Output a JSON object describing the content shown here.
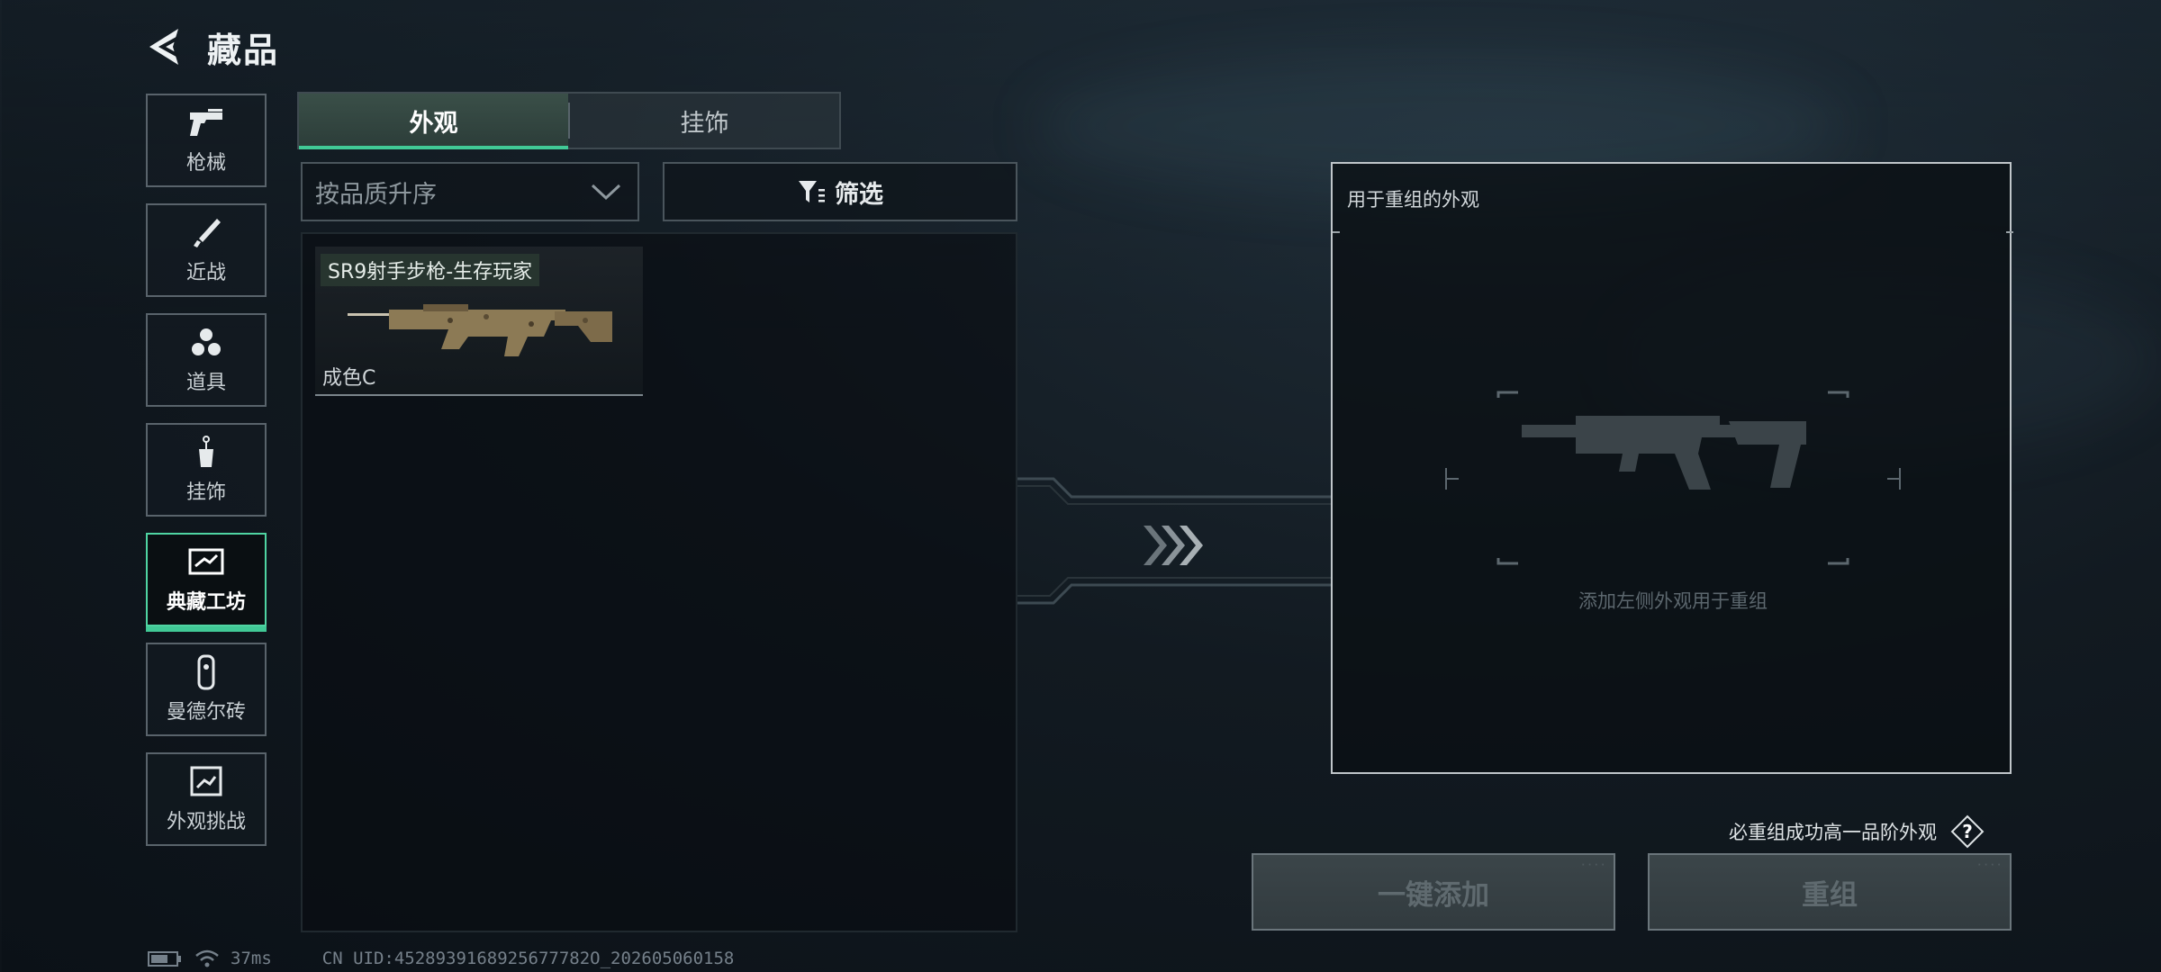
{
  "header": {
    "title": "藏品",
    "back_icon": "back-arrow-icon"
  },
  "sidebar": {
    "items": [
      {
        "label": "枪械",
        "icon": "pistol-icon",
        "active": false
      },
      {
        "label": "近战",
        "icon": "knife-icon",
        "active": false
      },
      {
        "label": "道具",
        "icon": "grenade-cluster-icon",
        "active": false
      },
      {
        "label": "挂饰",
        "icon": "charm-icon",
        "active": false
      },
      {
        "label": "典藏工坊",
        "icon": "workshop-icon",
        "active": true
      },
      {
        "label": "曼德尔砖",
        "icon": "brick-icon",
        "active": false
      },
      {
        "label": "外观挑战",
        "icon": "challenge-icon",
        "active": false
      }
    ]
  },
  "tabs": [
    {
      "label": "外观",
      "active": true
    },
    {
      "label": "挂饰",
      "active": false
    }
  ],
  "sort": {
    "value": "按品质升序",
    "icon": "chevron-down-icon"
  },
  "filter": {
    "label": "筛选",
    "icon": "filter-icon"
  },
  "items": [
    {
      "name": "SR9射手步枪-生存玩家",
      "grade": "成色C",
      "icon": "rifle-icon"
    }
  ],
  "recombine": {
    "title": "用于重组的外观",
    "hint": "添加左侧外观用于重组",
    "placeholder_icon": "rifle-silhouette-icon",
    "arrows_icon": "triple-chevron-right-icon"
  },
  "footer": {
    "guarantee_text": "必重组成功高一品阶外观",
    "help_icon": "question-diamond-icon",
    "add_all_label": "一键添加",
    "recombine_label": "重组"
  },
  "status": {
    "latency": "37ms",
    "uid": "CN UID:4528939168925677782O_202605060158"
  },
  "colors": {
    "accent": "#41c996",
    "panel_border": "#c0c6ca"
  }
}
